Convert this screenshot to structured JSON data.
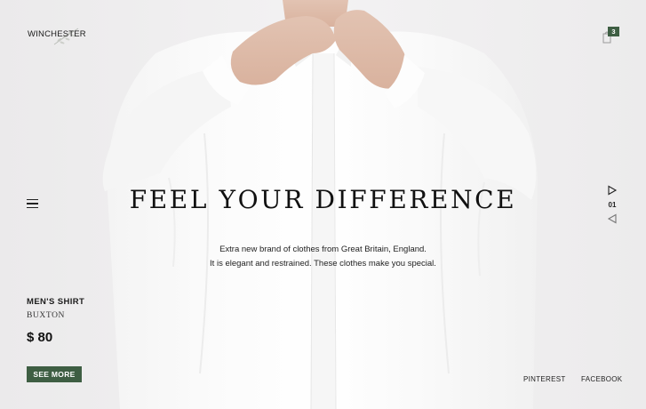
{
  "header": {
    "brand": "WINCHESTER",
    "cart_count": "3"
  },
  "hero": {
    "headline": "FEEL YOUR DIFFERENCE",
    "subtitle_line1": "Extra new brand of clothes from Great Britain, England.",
    "subtitle_line2": "It is elegant and restrained. These clothes make you special."
  },
  "slider": {
    "current": "01"
  },
  "product": {
    "category": "MEN'S SHIRT",
    "name": "BUXTON",
    "price": "$ 80",
    "cta": "SEE MORE"
  },
  "social": {
    "pinterest": "PINTEREST",
    "facebook": "FACEBOOK"
  },
  "colors": {
    "background": "#efeeef",
    "accent_green": "#3e5e43",
    "text": "#1d1d1d"
  },
  "icons": {
    "menu": "hamburger-icon",
    "cart": "shopping-bag-icon",
    "next": "play-triangle-icon",
    "prev": "back-triangle-icon",
    "logo_decor": "leaf-sprig-icon"
  }
}
